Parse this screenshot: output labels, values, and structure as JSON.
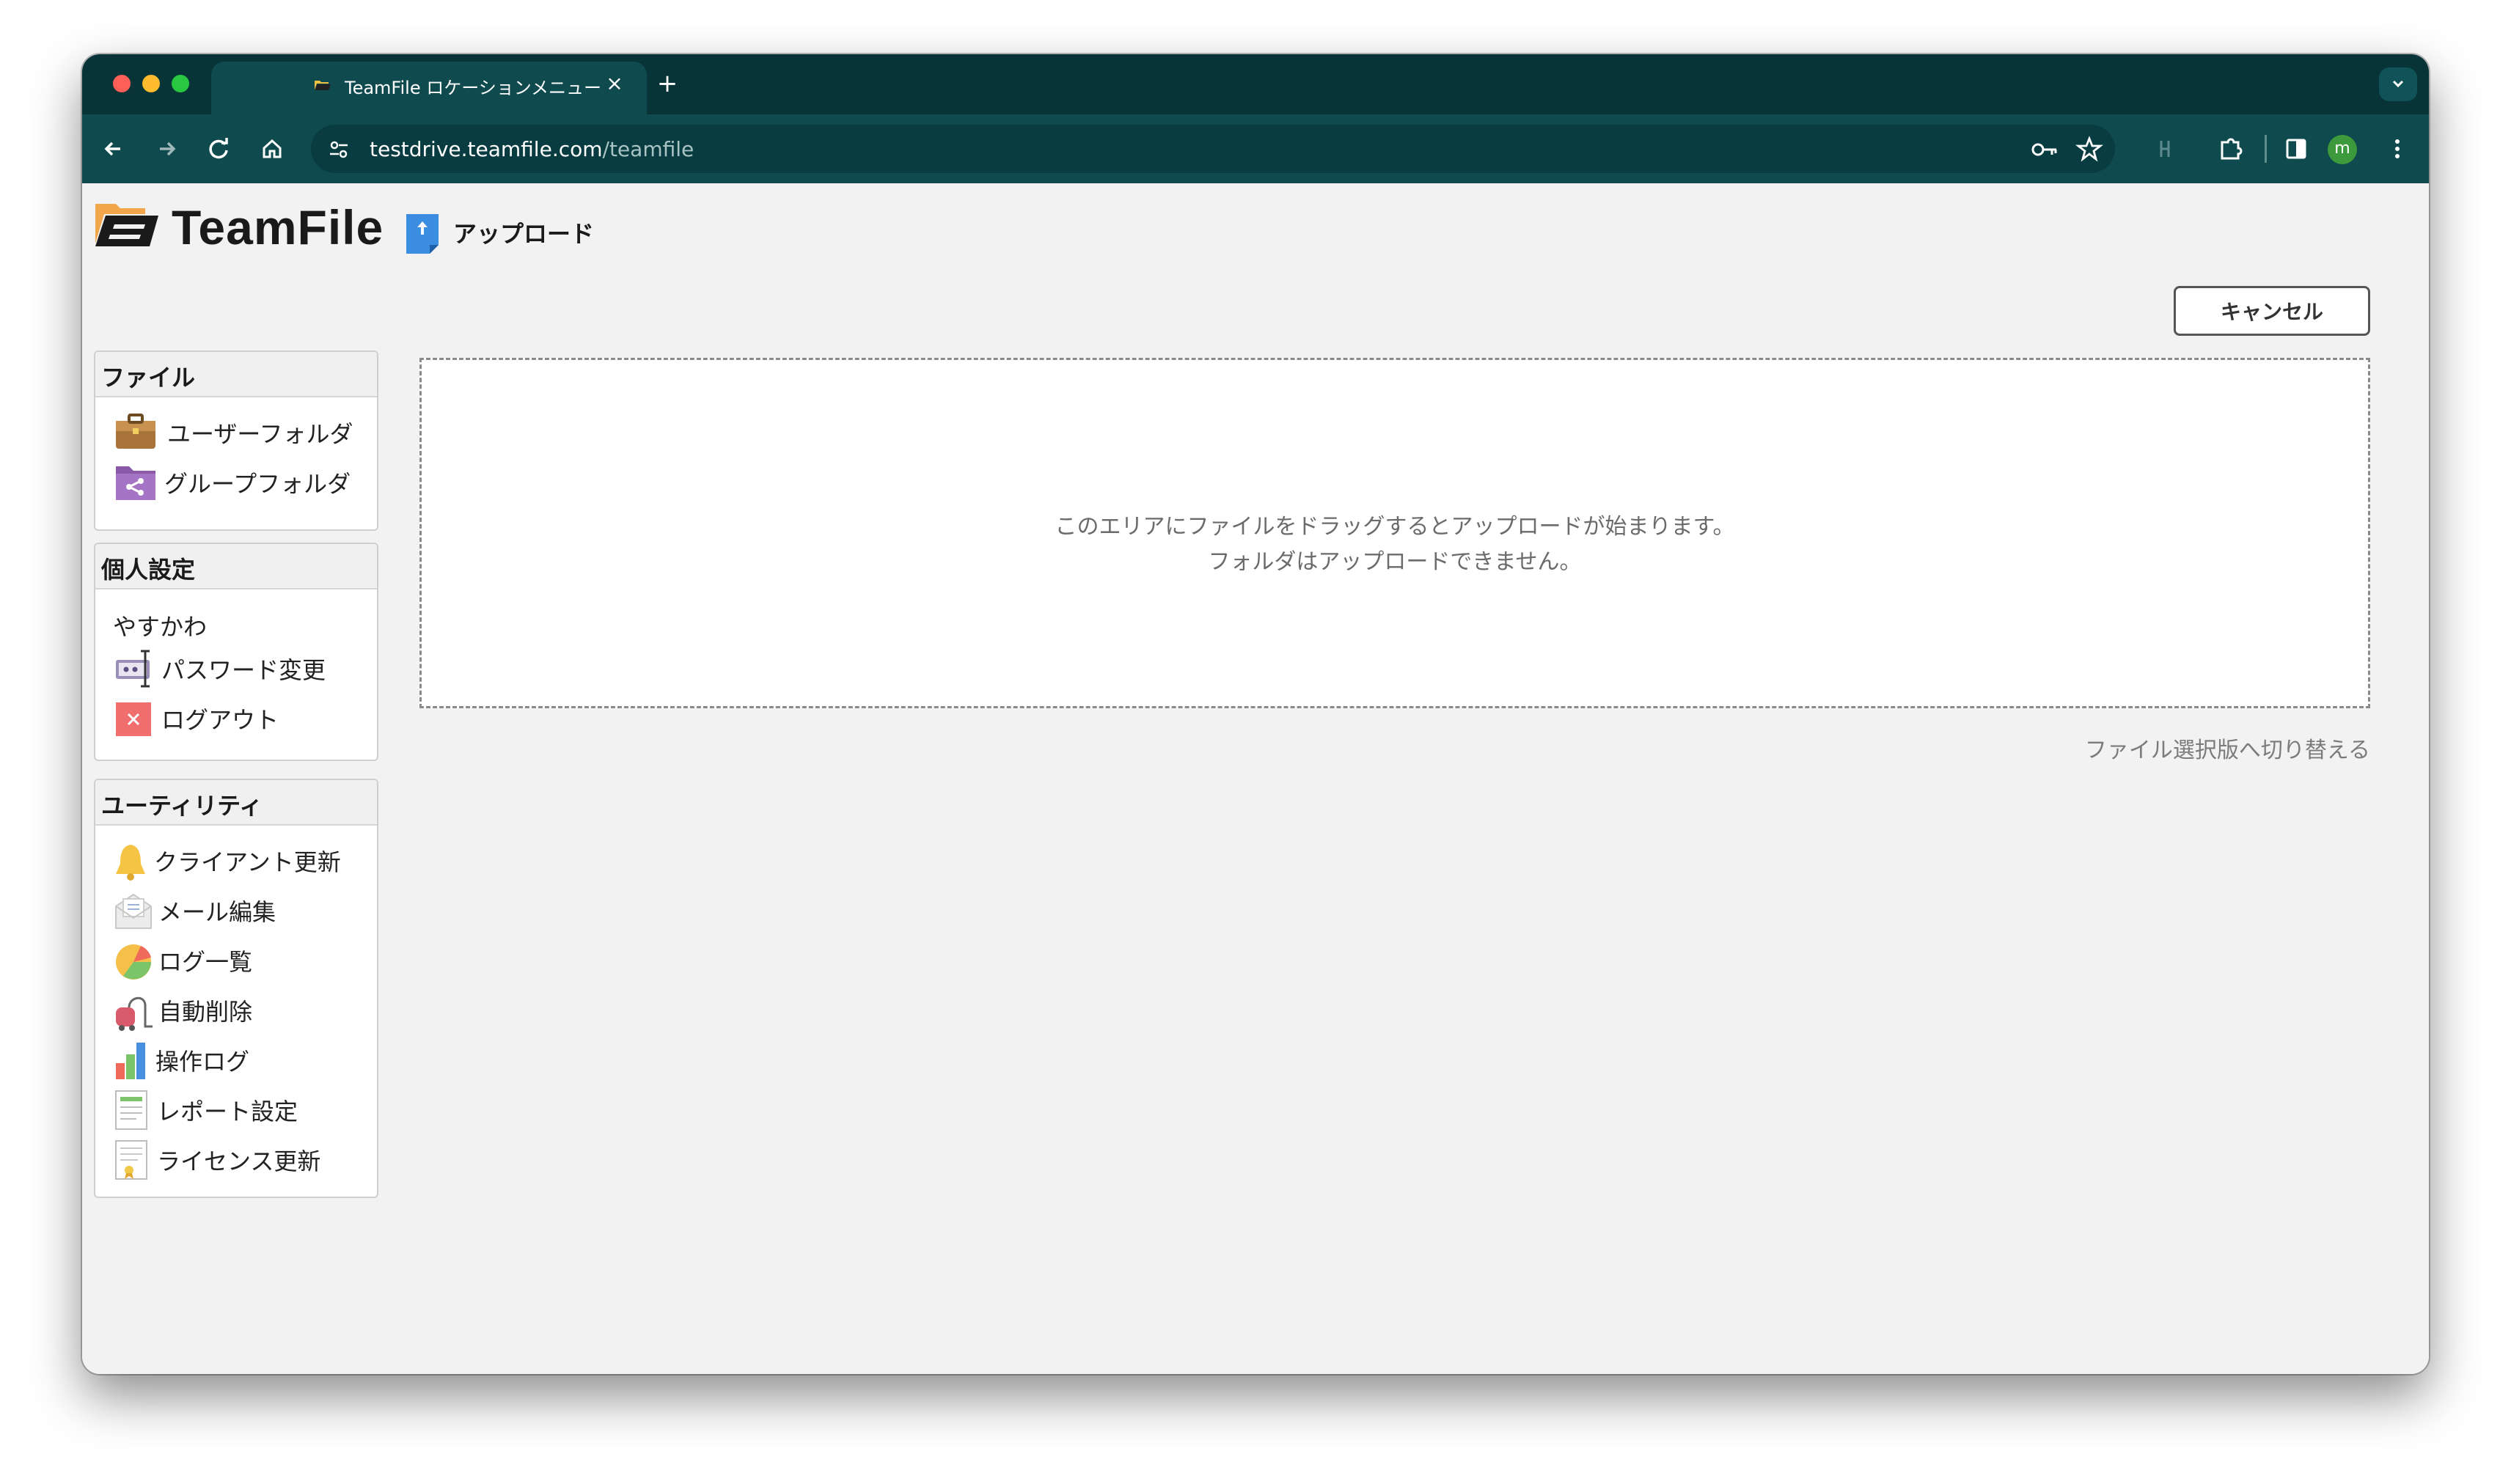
{
  "browser": {
    "tab_title": "TeamFile ロケーションメニュー",
    "tab_close": "×",
    "new_tab": "+",
    "url_host": "testdrive.teamfile.com",
    "url_path": "/teamfile",
    "profile_initial": "m"
  },
  "app": {
    "logo_text": "TeamFile",
    "page_title": "アップロード",
    "cancel_label": "キャンセル"
  },
  "sidebar": {
    "file_section": {
      "title": "ファイル",
      "items": [
        {
          "label": "ユーザーフォルダ",
          "icon": "briefcase-icon"
        },
        {
          "label": "グループフォルダ",
          "icon": "share-folder-icon"
        }
      ]
    },
    "personal_section": {
      "title": "個人設定",
      "user_name": "やすかわ",
      "items": [
        {
          "label": "パスワード変更",
          "icon": "password-icon"
        },
        {
          "label": "ログアウト",
          "icon": "logout-icon"
        }
      ]
    },
    "utility_section": {
      "title": "ユーティリティ",
      "items": [
        {
          "label": "クライアント更新",
          "icon": "bell-icon"
        },
        {
          "label": "メール編集",
          "icon": "mail-icon"
        },
        {
          "label": "ログ一覧",
          "icon": "pie-chart-icon"
        },
        {
          "label": "自動削除",
          "icon": "vacuum-icon"
        },
        {
          "label": "操作ログ",
          "icon": "bar-chart-icon"
        },
        {
          "label": "レポート設定",
          "icon": "report-icon"
        },
        {
          "label": "ライセンス更新",
          "icon": "license-icon"
        }
      ]
    }
  },
  "dropzone": {
    "line1": "このエリアにファイルをドラッグするとアップロードが始まります。",
    "line2": "フォルダはアップロードできません。"
  },
  "switch_link": "ファイル選択版へ切り替える",
  "colors": {
    "tabstrip": "#083437",
    "toolbar": "#0e4a4e",
    "page_bg": "#f2f2f2"
  }
}
